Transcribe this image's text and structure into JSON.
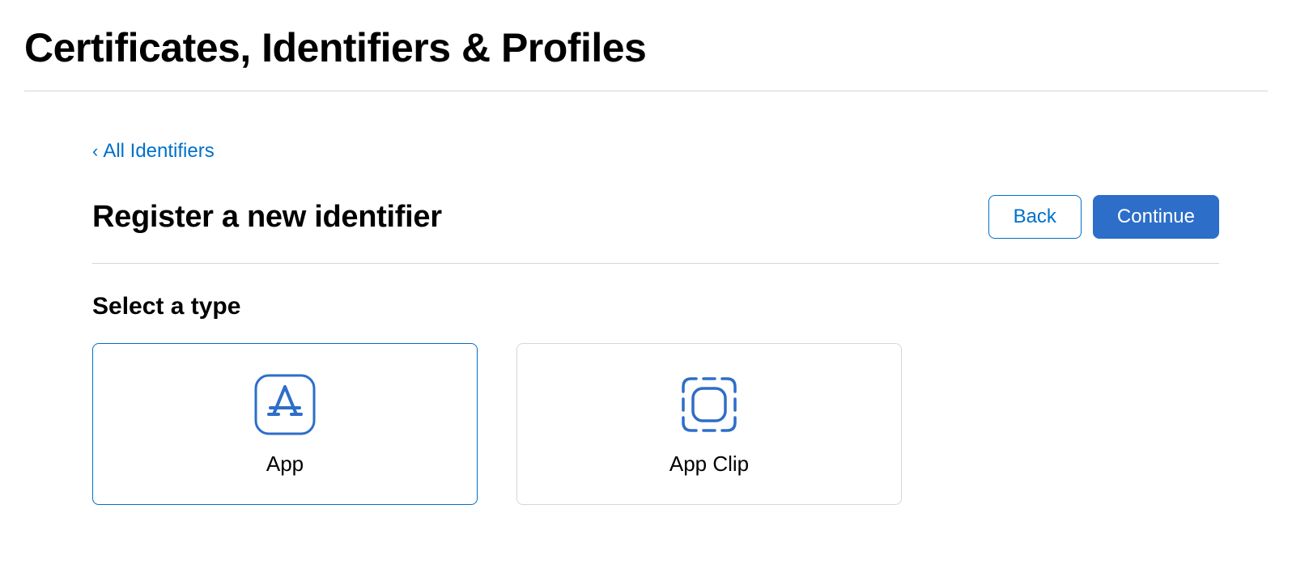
{
  "header": {
    "title": "Certificates, Identifiers & Profiles"
  },
  "breadcrumb": {
    "label": "All Identifiers"
  },
  "section": {
    "title": "Register a new identifier"
  },
  "buttons": {
    "back": "Back",
    "continue": "Continue"
  },
  "subsection": {
    "title": "Select a type"
  },
  "typeOptions": [
    {
      "label": "App",
      "selected": true
    },
    {
      "label": "App Clip",
      "selected": false
    }
  ],
  "colors": {
    "accent": "#0070c9",
    "primaryButton": "#2d6ec9"
  }
}
